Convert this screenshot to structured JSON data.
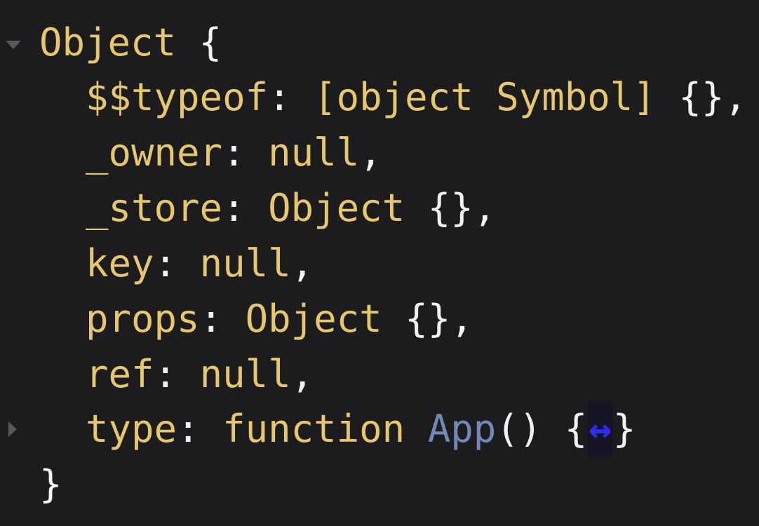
{
  "object_header": {
    "name": "Object",
    "open": "{"
  },
  "props": [
    {
      "key": "$$typeof",
      "sep": ": ",
      "value": "[object Symbol]",
      "brace": "{}",
      "comma": ","
    },
    {
      "key": "_owner",
      "sep": ": ",
      "value": "null",
      "comma": ","
    },
    {
      "key": "_store",
      "sep": ": ",
      "value": "Object",
      "brace": "{}",
      "comma": ","
    },
    {
      "key": "key",
      "sep": ": ",
      "value": "null",
      "comma": ","
    },
    {
      "key": "props",
      "sep": ": ",
      "value": "Object",
      "brace": "{}",
      "comma": ","
    },
    {
      "key": "ref",
      "sep": ": ",
      "value": "null",
      "comma": ","
    },
    {
      "key": "type",
      "sep": ": ",
      "value": "function",
      "fn_name": "App",
      "parens": "()",
      "brace_open": "{",
      "ellipsis": "↔",
      "brace_close": "}"
    }
  ],
  "object_footer": {
    "close": "}"
  },
  "icons": {
    "expanded_toggle": "disclosure-expanded-icon",
    "collapsed_toggle": "disclosure-collapsed-icon"
  },
  "colors": {
    "background": "#1c1b1e",
    "key": "#e6c76e",
    "brace": "#f2f2f2",
    "function_name": "#7289b8",
    "ellipsis": "#2d2dff"
  }
}
